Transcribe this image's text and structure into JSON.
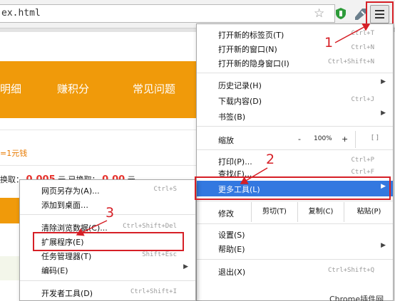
{
  "browser": {
    "url": "ex.html",
    "star_icon": "☆",
    "shield_icon": "shield-icon",
    "extension_icon": "extension-icon",
    "menu_icon": "hamburger-menu-icon"
  },
  "page": {
    "nav": [
      "明细",
      "赚积分",
      "常见问题"
    ],
    "text1": "=1元钱",
    "text2": "换取：",
    "text2_num1": "0.005",
    "text2_mid": "元 已换取：",
    "text2_num2": "0.00",
    "text2_tail": "元",
    "accent": "#f09a0a",
    "number_color": "#e8322d"
  },
  "main_menu": {
    "items": [
      {
        "label": "打开新的标签页(T)",
        "shortcut": "Ctrl+T"
      },
      {
        "label": "打开新的窗口(N)",
        "shortcut": "Ctrl+N"
      },
      {
        "label": "打开新的隐身窗口(I)",
        "shortcut": "Ctrl+Shift+N"
      },
      {
        "label": "历史记录(H)",
        "arrow": "▶"
      },
      {
        "label": "下载内容(D)",
        "shortcut": "Ctrl+J"
      },
      {
        "label": "书签(B)",
        "arrow": "▶"
      },
      {
        "label": "缩放",
        "zoom_minus": "-",
        "zoom_value": "100%",
        "zoom_plus": "+",
        "fullscreen": "[ ]"
      },
      {
        "label": "打印(P)...",
        "shortcut": "Ctrl+P"
      },
      {
        "label": "查找(F)...",
        "shortcut": "Ctrl+F"
      },
      {
        "label": "更多工具(L)",
        "arrow": "▶"
      },
      {
        "label": "修改",
        "cut": "剪切(T)",
        "copy": "复制(C)",
        "paste": "粘贴(P)"
      },
      {
        "label": "设置(S)"
      },
      {
        "label": "帮助(E)",
        "arrow": "▶"
      },
      {
        "label": "退出(X)",
        "shortcut": "Ctrl+Shift+Q"
      }
    ]
  },
  "sub_menu": {
    "items": [
      {
        "label": "网页另存为(A)...",
        "shortcut": "Ctrl+S"
      },
      {
        "label": "添加到桌面…"
      },
      {
        "label": "清除浏览数据(C)...",
        "shortcut": "Ctrl+Shift+Del"
      },
      {
        "label": "扩展程序(E)"
      },
      {
        "label": "任务管理器(T)",
        "shortcut": "Shift+Esc"
      },
      {
        "label": "编码(E)",
        "arrow": "▶"
      },
      {
        "label": "开发者工具(D)",
        "shortcut": "Ctrl+Shift+I"
      }
    ]
  },
  "annotations": {
    "step1": "1",
    "step2": "2",
    "step3": "3",
    "highlight_color": "#d61f26"
  },
  "watermark": "Chrome插件网"
}
